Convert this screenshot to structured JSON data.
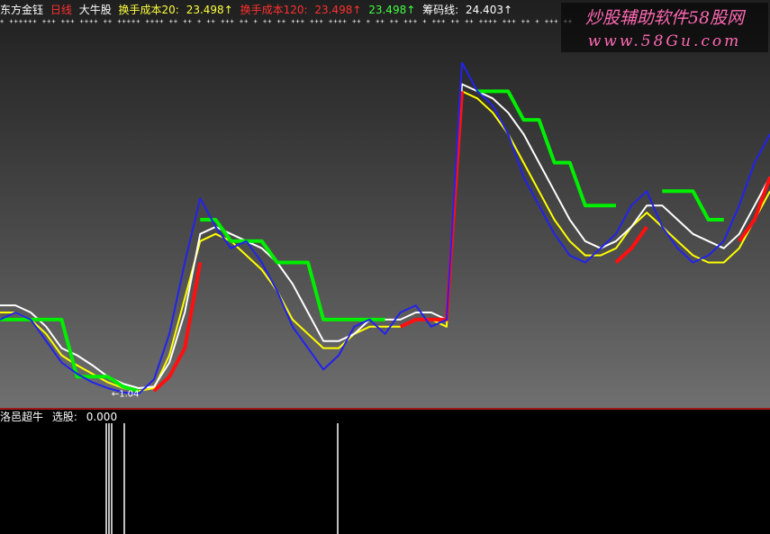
{
  "header": {
    "software": "东方金钰",
    "period": "日线",
    "formula": "大牛股",
    "ind1_label": "换手成本20:",
    "ind1_value": "23.498↑",
    "ind2_label": "换手成本120:",
    "ind2_value": "23.498↑",
    "ind3_value": "23.498↑",
    "ind4_label": "筹码线:",
    "ind4_value": "24.403↑",
    "crosses": "+ ++++++ +++ +++ ++++ ++ +++++ ++++ ++ ++ + ++ +++ ++ + ++ ++ +++ +++ ++++ ++ + ++ ++ +++ + +++ ++ ++ ++++ +++ ++ + +++ ++ +"
  },
  "watermark": {
    "title": "炒股辅助软件58股网",
    "url": "www.58Gu.com"
  },
  "sub_header": {
    "name": "洛邑超牛",
    "label": "选股:",
    "value": "0.000"
  },
  "low_label": "1.04",
  "colors": {
    "price": "#2222ee",
    "ma_white": "#ffffff",
    "ma_yellow": "#ffff00",
    "step_green": "#00ee00",
    "support_red": "#ff1010",
    "header_red": "#ff3030",
    "header_yellow": "#ffff40",
    "header_green": "#40ff40",
    "header_white": "#ffffff"
  },
  "chart_data": {
    "type": "line",
    "title": "",
    "xlabel": "",
    "ylabel": "",
    "series": [
      {
        "values": [
          22.0,
          22.5,
          22.0,
          20.5,
          19.0,
          18.2,
          17.6,
          17.2,
          16.9,
          16.8,
          17.8,
          21.0,
          26.0,
          30.5,
          28.5,
          27.0,
          27.5,
          26.0,
          24.0,
          21.5,
          20.0,
          18.5,
          19.5,
          21.5,
          22.0,
          21.0,
          22.5,
          23.0,
          21.5,
          22.0,
          40.0,
          38.0,
          37.0,
          35.0,
          32.0,
          30.0,
          28.0,
          26.5,
          26.0,
          27.0,
          28.0,
          30.0,
          31.0,
          28.5,
          27.0,
          26.0,
          26.5,
          27.5,
          30.0,
          33.0,
          35.0
        ]
      },
      {
        "values": [
          23.0,
          23.0,
          22.5,
          21.5,
          20.0,
          19.5,
          18.8,
          18.0,
          17.5,
          17.2,
          17.3,
          19.0,
          22.5,
          28.0,
          28.5,
          28.0,
          27.5,
          27.0,
          26.0,
          24.5,
          22.5,
          20.5,
          20.5,
          21.0,
          22.0,
          22.0,
          22.0,
          22.5,
          22.5,
          22.0,
          38.5,
          38.0,
          37.5,
          36.5,
          35.0,
          33.0,
          31.0,
          29.0,
          27.5,
          27.0,
          27.5,
          28.5,
          30.0,
          30.0,
          29.0,
          28.0,
          27.5,
          27.0,
          28.0,
          30.0,
          32.0
        ]
      },
      {
        "values": [
          22.5,
          22.5,
          22.0,
          21.0,
          19.5,
          18.8,
          18.2,
          17.6,
          17.2,
          17.0,
          17.2,
          19.5,
          23.5,
          27.5,
          28.0,
          27.5,
          26.5,
          25.5,
          24.0,
          22.0,
          21.0,
          20.0,
          20.0,
          21.0,
          21.5,
          21.5,
          21.5,
          22.0,
          22.0,
          21.5,
          38.0,
          37.5,
          36.5,
          35.0,
          33.0,
          31.0,
          29.0,
          27.5,
          26.5,
          26.5,
          27.0,
          28.5,
          29.5,
          28.5,
          27.5,
          26.5,
          26.0,
          26.0,
          27.0,
          29.0,
          31.0
        ]
      },
      {
        "values": [
          22.0,
          22.0,
          22.0,
          22.0,
          22.0,
          18.0,
          18.0,
          18.0,
          17.3,
          17.0,
          null,
          null,
          null,
          29.0,
          29.0,
          27.5,
          27.5,
          27.5,
          26.0,
          26.0,
          26.0,
          22.0,
          22.0,
          22.0,
          22.0,
          22.0,
          null,
          null,
          null,
          null,
          null,
          38.0,
          38.0,
          38.0,
          36.0,
          36.0,
          33.0,
          33.0,
          30.0,
          30.0,
          30.0,
          null,
          null,
          31.0,
          31.0,
          31.0,
          29.0,
          29.0,
          null,
          null,
          null
        ]
      },
      {
        "values": [
          null,
          null,
          null,
          null,
          null,
          null,
          null,
          null,
          null,
          null,
          17.0,
          18.0,
          20.0,
          26.0,
          null,
          null,
          null,
          null,
          null,
          null,
          null,
          null,
          null,
          null,
          null,
          null,
          21.5,
          22.0,
          22.0,
          22.0,
          38.0,
          null,
          null,
          null,
          null,
          null,
          null,
          null,
          null,
          null,
          26.0,
          27.0,
          28.5,
          null,
          null,
          null,
          null,
          null,
          27.5,
          29.0,
          32.0
        ]
      }
    ]
  }
}
